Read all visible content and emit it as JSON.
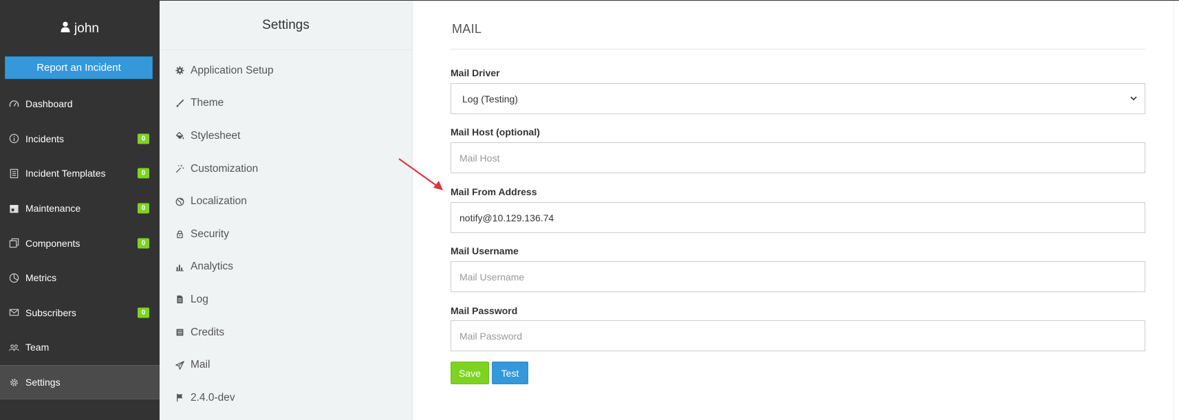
{
  "user": {
    "name": "john",
    "icon": "user-icon"
  },
  "sidebar": {
    "report_button": "Report an Incident",
    "items": [
      {
        "label": "Dashboard",
        "icon": "dashboard-icon"
      },
      {
        "label": "Incidents",
        "icon": "info-icon",
        "badge": "0"
      },
      {
        "label": "Incident Templates",
        "icon": "document-icon",
        "badge": "0"
      },
      {
        "label": "Maintenance",
        "icon": "calendar-icon",
        "badge": "0"
      },
      {
        "label": "Components",
        "icon": "copy-icon",
        "badge": "0"
      },
      {
        "label": "Metrics",
        "icon": "pie-chart-icon"
      },
      {
        "label": "Subscribers",
        "icon": "mail-icon",
        "badge": "0"
      },
      {
        "label": "Team",
        "icon": "team-icon"
      },
      {
        "label": "Settings",
        "icon": "gear-icon",
        "active": true
      }
    ]
  },
  "settings": {
    "title": "Settings",
    "items": [
      {
        "label": "Application Setup",
        "icon": "gear-icon"
      },
      {
        "label": "Theme",
        "icon": "brush-icon"
      },
      {
        "label": "Stylesheet",
        "icon": "paint-bucket-icon"
      },
      {
        "label": "Customization",
        "icon": "magic-wand-icon"
      },
      {
        "label": "Localization",
        "icon": "globe-icon"
      },
      {
        "label": "Security",
        "icon": "lock-icon"
      },
      {
        "label": "Analytics",
        "icon": "bar-chart-icon"
      },
      {
        "label": "Log",
        "icon": "file-icon"
      },
      {
        "label": "Credits",
        "icon": "list-icon"
      },
      {
        "label": "Mail",
        "icon": "paper-plane-icon"
      },
      {
        "label": "2.4.0-dev",
        "icon": "flag-icon"
      }
    ]
  },
  "mail": {
    "section_title": "MAIL",
    "driver": {
      "label": "Mail Driver",
      "value": "Log (Testing)"
    },
    "host": {
      "label": "Mail Host (optional)",
      "value": "",
      "placeholder": "Mail Host"
    },
    "from": {
      "label": "Mail From Address",
      "value": "notify@10.129.136.74",
      "placeholder": ""
    },
    "username": {
      "label": "Mail Username",
      "value": "",
      "placeholder": "Mail Username"
    },
    "password": {
      "label": "Mail Password",
      "value": "",
      "placeholder": "Mail Password"
    },
    "save_button": "Save",
    "test_button": "Test"
  },
  "colors": {
    "sidebar_bg": "#333333",
    "primary": "#3498db",
    "success": "#7ed321",
    "annotation_arrow": "#d9363e"
  }
}
